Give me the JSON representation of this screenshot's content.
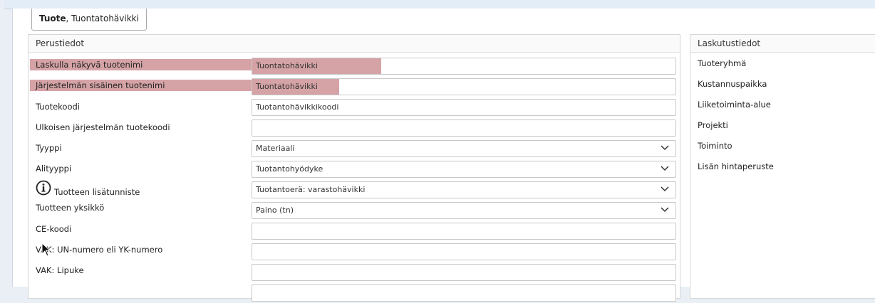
{
  "tab": {
    "bold": "Tuote",
    "rest": ", Tuontatohävikki"
  },
  "basic": {
    "title": "Perustiedot",
    "rows": [
      {
        "label": "Laskulla näkyvä tuotenimi",
        "value": "Tuontatohävikki"
      },
      {
        "label": "Järjestelmän sisäinen tuotenimi",
        "value": "Tuontatohävikki"
      },
      {
        "label": "Tuotekoodi",
        "value": "Tuotantohävikkikoodi"
      },
      {
        "label": "Ulkoisen järjestelmän tuotekoodi",
        "value": ""
      },
      {
        "label": "Tyyppi",
        "value": "Materiaali"
      },
      {
        "label": "Alityyppi",
        "value": "Tuotantohyödyke"
      },
      {
        "label": "Tuotteen lisätunniste",
        "value": "Tuotantoerä: varastohävikki"
      },
      {
        "label": "Tuotteen yksikkö",
        "value": "Paino (tn)"
      },
      {
        "label": "CE-koodi",
        "value": ""
      },
      {
        "label": "VAK: UN-numero eli YK-numero",
        "value": ""
      },
      {
        "label": "VAK: Lipuke",
        "value": ""
      }
    ]
  },
  "billing": {
    "title": "Laskutustiedot",
    "items": [
      "Tuoteryhmä",
      "Kustannuspaikka",
      "Liiketoiminta-alue",
      "Projekti",
      "Toiminto",
      "Lisän hintaperuste"
    ]
  },
  "colors": {
    "highlight": "#d5a3a6",
    "border": "#c8c8c8"
  },
  "icons": {
    "dropdown": "chevron-down-icon",
    "info": "info-icon",
    "cursor": "mouse-pointer-icon"
  }
}
